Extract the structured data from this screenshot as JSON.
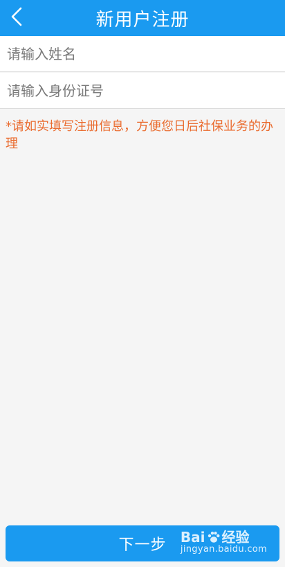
{
  "header": {
    "title": "新用户注册",
    "back_icon": "chevron-left-icon",
    "bg_color": "#1a9af0"
  },
  "form": {
    "name_placeholder": "请输入姓名",
    "id_placeholder": "请输入身份证号"
  },
  "notice": {
    "text": "*请如实填写注册信息，方便您日后社保业务的办理",
    "color": "#ea6b2e"
  },
  "footer": {
    "next_label": "下一步"
  },
  "watermark": {
    "brand_left": "Bai",
    "brand_right": "经验",
    "url": "jingyan.baidu.com"
  }
}
